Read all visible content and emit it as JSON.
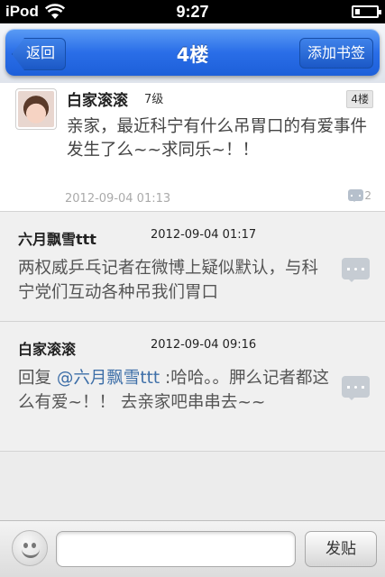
{
  "status_bar": {
    "carrier": "iPod",
    "time": "9:27"
  },
  "nav": {
    "back_label": "返回",
    "title": "4楼",
    "bookmark_label": "添加书签",
    "accent": "#2a6ee8"
  },
  "main_post": {
    "author": "白家滚滚",
    "level": "7级",
    "floor_badge": "4楼",
    "content": "亲家，最近科宁有什么吊胃口的有爱事件发生了么~~求同乐~！！",
    "time": "2012-09-04 01:13",
    "comment_count": "2"
  },
  "replies": [
    {
      "author": "六月飘雪ttt",
      "time": "2012-09-04 01:17",
      "content": "两权威乒乓记者在微博上疑似默认，与科宁党们互动各种吊我们胃口"
    },
    {
      "author": "白家滚滚",
      "time": "2012-09-04 09:16",
      "reply_prefix": "回复 ",
      "mention": "@六月飘雪ttt",
      "content": " :哈哈。。胛么记者都这么有爱~！！ 去亲家吧串串去~~"
    }
  ],
  "input_bar": {
    "placeholder": "",
    "send_label": "发贴"
  }
}
